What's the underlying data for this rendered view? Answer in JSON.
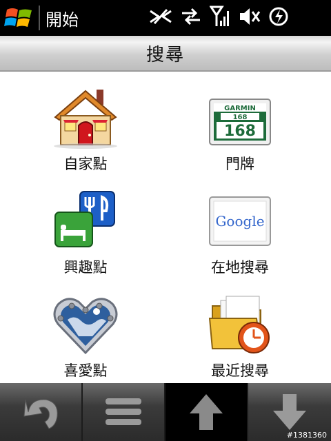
{
  "statusbar": {
    "start_label": "開始",
    "icons": [
      "windows-logo",
      "data-sync-icon",
      "transfer-arrows-icon",
      "signal-strength-icon",
      "volume-mute-icon",
      "battery-charging-icon"
    ]
  },
  "title": "搜尋",
  "grid": {
    "items": [
      {
        "label": "自家點",
        "icon": "home-icon"
      },
      {
        "label": "門牌",
        "icon": "address-sign-icon",
        "badge_brand": "GARMIN",
        "badge_small": "168",
        "badge_big": "168"
      },
      {
        "label": "興趣點",
        "icon": "poi-icon"
      },
      {
        "label": "在地搜尋",
        "icon": "google-icon",
        "brand": "Google"
      },
      {
        "label": "喜愛點",
        "icon": "favorite-heart-icon"
      },
      {
        "label": "最近搜尋",
        "icon": "recent-folder-icon"
      }
    ]
  },
  "bottombar": {
    "buttons": [
      {
        "icon": "back-icon"
      },
      {
        "icon": "menu-icon"
      },
      {
        "icon": "scroll-up-icon"
      },
      {
        "icon": "scroll-down-icon"
      }
    ]
  },
  "watermark": "#1381360",
  "colors": {
    "accent_green": "#2e8b2e",
    "tab_active": "#000000"
  }
}
